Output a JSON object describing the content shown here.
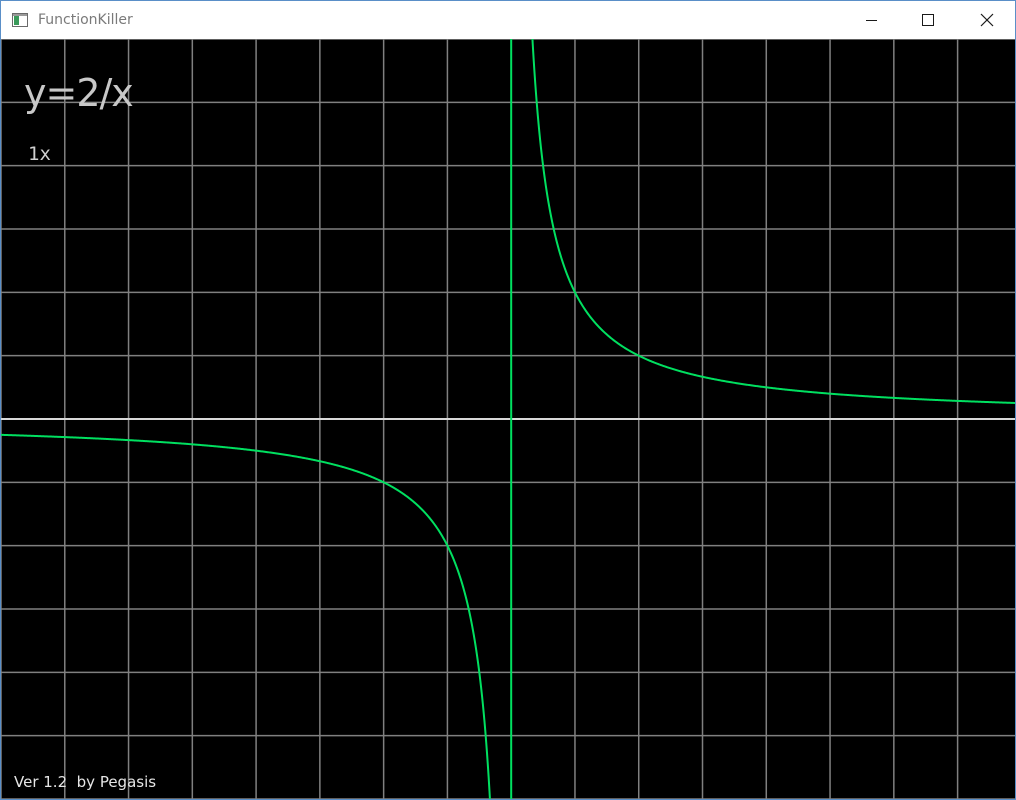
{
  "window": {
    "title": "FunctionKiller",
    "icon": "app-window-icon",
    "controls": {
      "minimize": "minimize-icon",
      "maximize": "maximize-icon",
      "close": "close-icon"
    }
  },
  "canvas": {
    "function_label": "y=2/x",
    "scale_label": "1x",
    "version_label": "Ver 1.2  by Pegasis"
  },
  "colors": {
    "background": "#000000",
    "grid": "#808080",
    "x_axis": "#d8d8d8",
    "y_axis": "#00e060",
    "curve": "#00e060"
  },
  "chart_data": {
    "type": "line",
    "title": "y=2/x",
    "function": "y=2/x",
    "series": [
      {
        "name": "",
        "x": [
          -8,
          -6,
          -4,
          -3,
          -2,
          -1.5,
          -1,
          -0.75,
          -0.5,
          -0.375,
          -0.3,
          -0.25,
          0.25,
          0.3,
          0.4,
          0.5,
          0.75,
          1,
          1.5,
          2,
          3,
          4,
          6,
          8
        ],
        "y": [
          -0.25,
          -0.3333,
          -0.5,
          -0.6667,
          -1,
          -1.3333,
          -2,
          -2.6667,
          -4,
          -5.3333,
          -6.6667,
          -8,
          8,
          6.6667,
          5,
          4,
          2.6667,
          2,
          1.3333,
          1,
          0.6667,
          0.5,
          0.3333,
          0.25
        ]
      }
    ],
    "xlim": [
      -8,
      7.9
    ],
    "ylim": [
      -6,
      6
    ],
    "grid": true,
    "xlabel": "",
    "ylabel": ""
  }
}
